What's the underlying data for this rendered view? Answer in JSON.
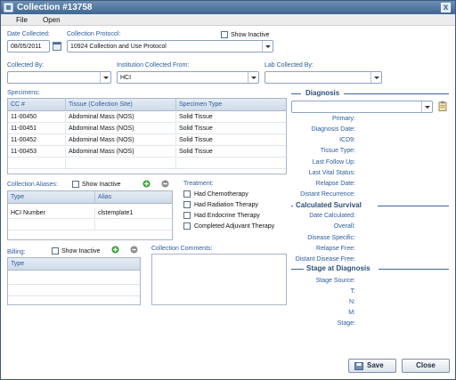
{
  "window": {
    "title": "Collection #13758",
    "close_label": "x"
  },
  "menu": {
    "items": [
      "File",
      "Open"
    ]
  },
  "form": {
    "date_collected_label": "Date Collected:",
    "date_collected_value": "08/05/2011",
    "protocol_label": "Collection Protocol:",
    "protocol_value": "10924 Collection and Use Protocol",
    "show_inactive_label": "Show Inactive",
    "collected_by_label": "Collected By:",
    "collected_by_value": "",
    "institution_label": "Institution Collected From:",
    "institution_value": "HCI",
    "lab_label": "Lab Collected By:",
    "lab_value": ""
  },
  "specimens": {
    "label": "Specimens:",
    "columns": [
      "CC #",
      "Tissue (Collection Site)",
      "Specimen Type"
    ],
    "rows": [
      [
        "11-00450",
        "Abdominal Mass (NOS)",
        "Solid Tissue"
      ],
      [
        "11-00451",
        "Abdominal Mass (NOS)",
        "Solid Tissue"
      ],
      [
        "11-00452",
        "Abdominal Mass (NOS)",
        "Solid Tissue"
      ],
      [
        "11-00453",
        "Abdominal Mass (NOS)",
        "Solid Tissue"
      ]
    ]
  },
  "aliases": {
    "label": "Collection Aliases:",
    "show_inactive_label": "Show Inactive",
    "columns": [
      "Type",
      "Alias"
    ],
    "rows": [
      [
        "HCI Number",
        "clstemplate1"
      ]
    ]
  },
  "treatment": {
    "label": "Treatment:",
    "options": [
      "Had Chemotherapy",
      "Had Radiation Therapy",
      "Had Endocrine Therapy",
      "Completed Adjuvant Therapy"
    ]
  },
  "billing": {
    "label": "Billing:",
    "show_inactive_label": "Show Inactive",
    "columns": [
      "Type"
    ]
  },
  "comments": {
    "label": "Collection Comments:"
  },
  "diagnosis": {
    "title": "Diagnosis",
    "value": "",
    "fields": [
      "Primary:",
      "Diagnosis Date:",
      "ICD9:",
      "Tissue Type:",
      "Last Follow Up:",
      "Last Vital Status:",
      "Relapse Date:",
      "Distant Recurrence:"
    ]
  },
  "survival": {
    "title": "Calculated Survival",
    "fields": [
      "Date Calculated:",
      "Overall:",
      "Disease Specific:",
      "Relapse Free:",
      "Distant Disease Free:"
    ]
  },
  "stage": {
    "title": "Stage at Diagnosis",
    "fields": [
      "Stage Source:",
      "T:",
      "N:",
      "M:",
      "Stage:"
    ]
  },
  "actions": {
    "save_label": "Save",
    "close_label": "Close"
  },
  "colors": {
    "title_bar": "#3e6691",
    "label_blue": "#2b5c9b",
    "add_green": "#3aa33a",
    "remove_gray": "#8c8c8c"
  }
}
